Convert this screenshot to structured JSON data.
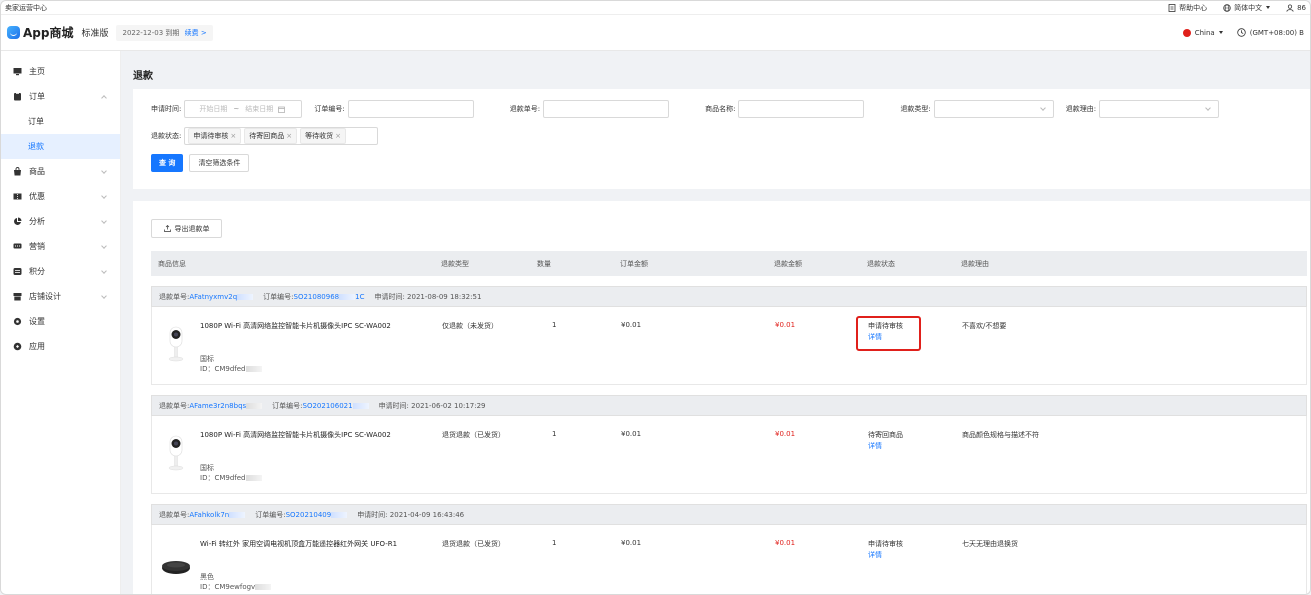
{
  "top_strip": {
    "left_text": "卖家运营中心",
    "help": "帮助中心",
    "language": "简体中文",
    "account": "86"
  },
  "header": {
    "app_name": "App商城",
    "edition": "标准版",
    "expire_text": "2022-12-03 到期",
    "renew_label": "续费 >",
    "country": "China",
    "timezone": "(GMT+08:00) B"
  },
  "sidebar": {
    "items": [
      {
        "label": "主页",
        "icon": "monitor-icon"
      },
      {
        "label": "订单",
        "icon": "clipboard-icon"
      },
      {
        "label": "订单",
        "sub": true
      },
      {
        "label": "退款",
        "sub": true,
        "active": true
      },
      {
        "label": "商品",
        "icon": "bag-icon"
      },
      {
        "label": "优惠",
        "icon": "coupon-icon"
      },
      {
        "label": "分析",
        "icon": "pie-icon"
      },
      {
        "label": "营销",
        "icon": "megaphone-icon"
      },
      {
        "label": "积分",
        "icon": "points-icon"
      },
      {
        "label": "店铺设计",
        "icon": "store-icon"
      },
      {
        "label": "设置",
        "icon": "gear-icon"
      },
      {
        "label": "应用",
        "icon": "app-icon"
      }
    ]
  },
  "page": {
    "title": "退款"
  },
  "filters": {
    "apply_time_label": "申请时间:",
    "start_placeholder": "开始日期",
    "end_placeholder": "结束日期",
    "date_sep": "~",
    "order_no_label": "订单编号:",
    "refund_no_label": "退款单号:",
    "product_name_label": "商品名称:",
    "refund_type_label": "退款类型:",
    "refund_reason_label": "退款理由:",
    "refund_status_label": "退款状态:",
    "status_tags": [
      "申请待审核",
      "待寄回商品",
      "等待收货"
    ],
    "query_button": "查 询",
    "clear_button": "清空筛选条件"
  },
  "list": {
    "export_button": "导出退款单",
    "columns": [
      "商品信息",
      "退款类型",
      "数量",
      "订单金额",
      "退款金额",
      "退款状态",
      "退款理由"
    ],
    "refund_no_prefix": "退款单号:",
    "order_no_prefix": "订单编号:",
    "apply_time_prefix": "申请时间:",
    "rows": [
      {
        "refund_no": "AFatnyxmv2q",
        "order_no": "SO21080968",
        "order_no_suffix": "1C",
        "apply_time": "2021-08-09 18:32:51",
        "product": "1080P Wi-Fi 高清网络监控智能卡片机摄像头IPC SC-WA002",
        "attr": "国标",
        "id": "ID：CM9dfed",
        "refund_type": "仅退款（未发货）",
        "qty": "1",
        "order_amount": "¥0.01",
        "refund_amount": "¥0.01",
        "status": "申请待审核",
        "detail_link": "详情",
        "reason": "不喜欢/不想要",
        "image": "camera",
        "highlighted": true
      },
      {
        "refund_no": "AFame3r2n8bqs",
        "order_no": "SO202106021",
        "order_no_suffix": "",
        "apply_time": "2021-06-02 10:17:29",
        "product": "1080P Wi-Fi 高清网络监控智能卡片机摄像头IPC SC-WA002",
        "attr": "国标",
        "id": "ID：CM9dfed",
        "refund_type": "退货退款（已发货）",
        "qty": "1",
        "order_amount": "¥0.01",
        "refund_amount": "¥0.01",
        "status": "待寄回商品",
        "detail_link": "详情",
        "reason": "商品颜色规格与描述不符",
        "image": "camera",
        "highlighted": false
      },
      {
        "refund_no": "AFahkolk7n",
        "order_no": "SO20210409",
        "order_no_suffix": "",
        "apply_time": "2021-04-09 16:43:46",
        "product": "Wi-Fi 转红外 家用空调电视机顶盒万能遥控器红外网关 UFO-R1",
        "attr": "黑色",
        "id": "ID：CM9ewfogv",
        "refund_type": "退货退款（已发货）",
        "qty": "1",
        "order_amount": "¥0.01",
        "refund_amount": "¥0.01",
        "status": "申请待审核",
        "detail_link": "详情",
        "reason": "七天无理由退换货",
        "image": "ir-remote",
        "highlighted": false
      }
    ]
  },
  "colors": {
    "primary": "#1677ff",
    "danger": "#e0201b",
    "bg": "#f0f2f5"
  }
}
